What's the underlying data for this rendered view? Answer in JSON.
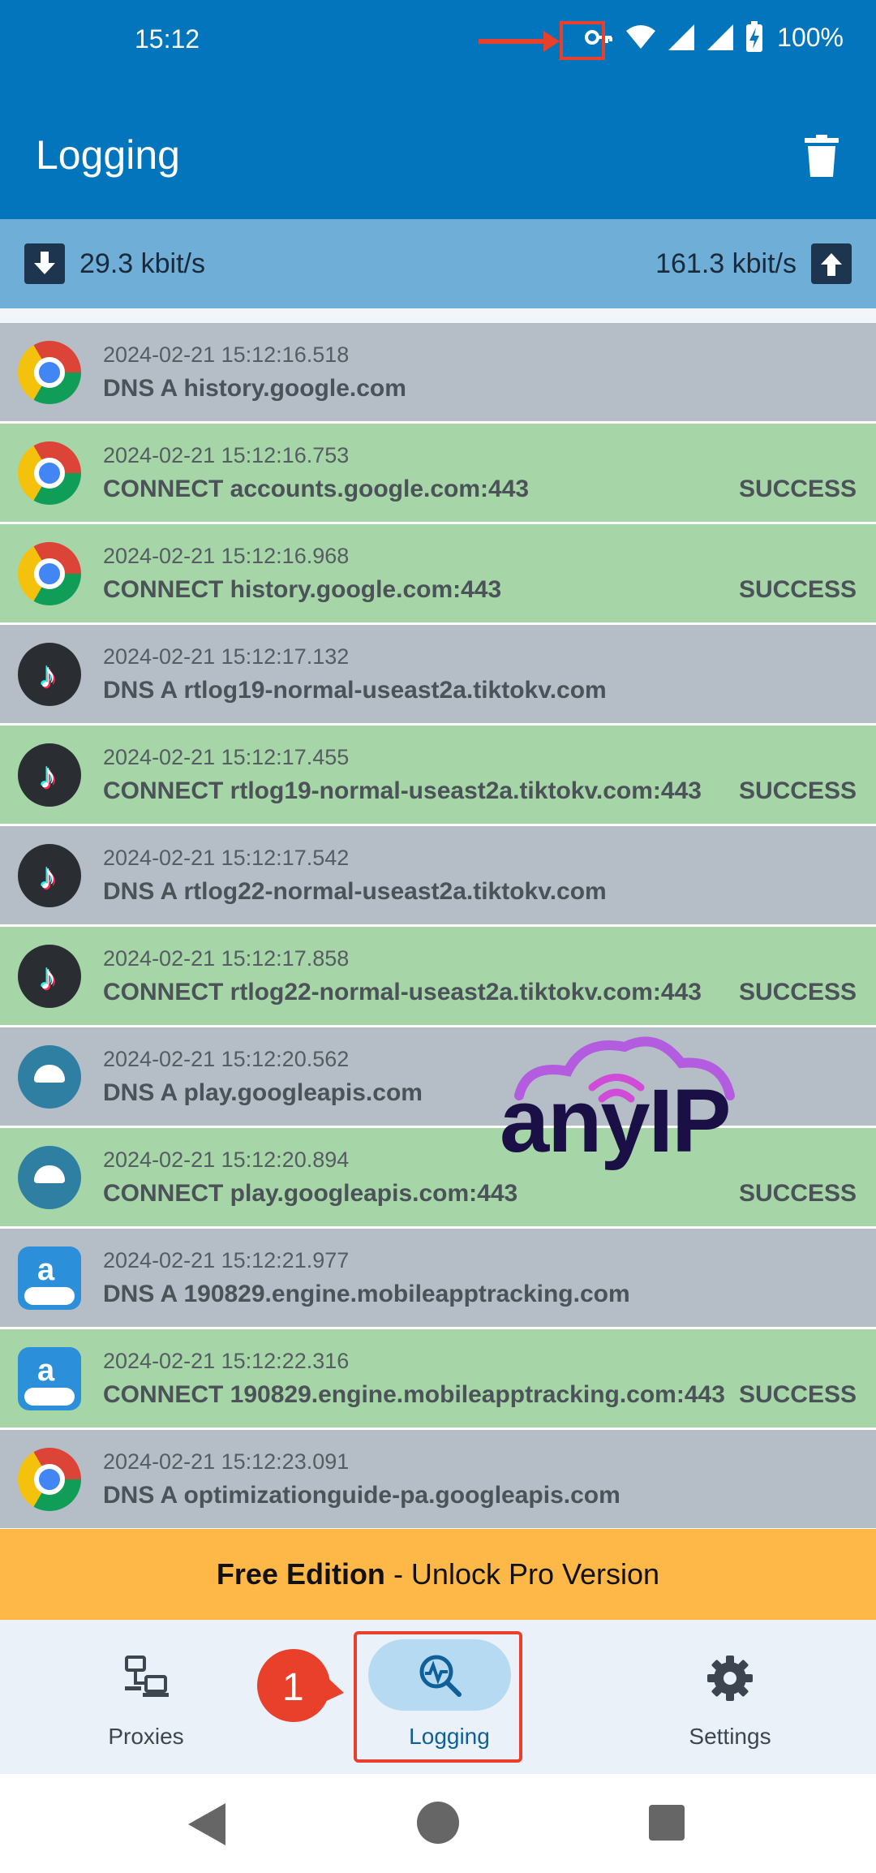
{
  "status_bar": {
    "time": "15:12",
    "battery_percent": "100%",
    "icons": [
      "vpn-key-icon",
      "wifi-icon",
      "signal-icon",
      "signal-icon",
      "battery-charging-icon"
    ]
  },
  "app_bar": {
    "title": "Logging",
    "action_icon": "trash-icon"
  },
  "speed": {
    "download": "29.3 kbit/s",
    "upload": "161.3 kbit/s"
  },
  "log_entries": [
    {
      "app": "chrome",
      "timestamp": "2024-02-21 15:12:16.518",
      "message": "DNS A history.google.com",
      "status": "",
      "color": "#b5bec7"
    },
    {
      "app": "chrome",
      "timestamp": "2024-02-21 15:12:16.753",
      "message": "CONNECT accounts.google.com:443",
      "status": "SUCCESS",
      "color": "#a6d5a7"
    },
    {
      "app": "chrome",
      "timestamp": "2024-02-21 15:12:16.968",
      "message": "CONNECT history.google.com:443",
      "status": "SUCCESS",
      "color": "#a6d5a7"
    },
    {
      "app": "tiktok",
      "timestamp": "2024-02-21 15:12:17.132",
      "message": "DNS A rtlog19-normal-useast2a.tiktokv.com",
      "status": "",
      "color": "#b5bec7"
    },
    {
      "app": "tiktok",
      "timestamp": "2024-02-21 15:12:17.455",
      "message": "CONNECT rtlog19-normal-useast2a.tiktokv.com:443",
      "status": "SUCCESS",
      "color": "#a6d5a7"
    },
    {
      "app": "tiktok",
      "timestamp": "2024-02-21 15:12:17.542",
      "message": "DNS A rtlog22-normal-useast2a.tiktokv.com",
      "status": "",
      "color": "#b5bec7"
    },
    {
      "app": "tiktok",
      "timestamp": "2024-02-21 15:12:17.858",
      "message": "CONNECT rtlog22-normal-useast2a.tiktokv.com:443",
      "status": "SUCCESS",
      "color": "#a6d5a7"
    },
    {
      "app": "android",
      "timestamp": "2024-02-21 15:12:20.562",
      "message": "DNS A play.googleapis.com",
      "status": "",
      "color": "#b5bec7"
    },
    {
      "app": "android",
      "timestamp": "2024-02-21 15:12:20.894",
      "message": "CONNECT play.googleapis.com:443",
      "status": "SUCCESS",
      "color": "#a6d5a7"
    },
    {
      "app": "amazon",
      "timestamp": "2024-02-21 15:12:21.977",
      "message": "DNS A 190829.engine.mobileapptracking.com",
      "status": "",
      "color": "#b5bec7"
    },
    {
      "app": "amazon",
      "timestamp": "2024-02-21 15:12:22.316",
      "message": "CONNECT 190829.engine.mobileapptracking.com:443",
      "status": "SUCCESS",
      "color": "#a6d5a7"
    },
    {
      "app": "chrome",
      "timestamp": "2024-02-21 15:12:23.091",
      "message": "DNS A optimizationguide-pa.googleapis.com",
      "status": "",
      "color": "#b5bec7"
    }
  ],
  "watermark": {
    "text": "anyIP"
  },
  "promo": {
    "bold": "Free Edition",
    "rest": " - Unlock Pro Version"
  },
  "bottom_nav": {
    "items": [
      {
        "label": "Proxies",
        "icon": "network-devices-icon",
        "active": false
      },
      {
        "label": "Logging",
        "icon": "log-search-icon",
        "active": true
      },
      {
        "label": "Settings",
        "icon": "gear-icon",
        "active": false
      }
    ]
  },
  "annotation": {
    "badge_number": "1",
    "accent_color": "#e8402a"
  },
  "colors": {
    "primary": "#0275bd",
    "speed_bar": "#6eaed7",
    "promo": "#fdb847"
  }
}
